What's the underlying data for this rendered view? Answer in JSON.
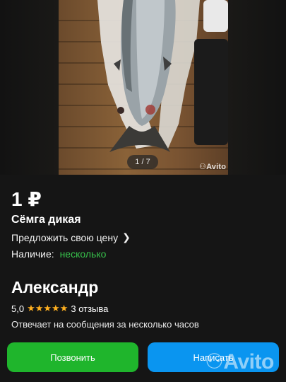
{
  "gallery": {
    "counter": "1 / 7",
    "watermark": "Avito"
  },
  "listing": {
    "price": "1 ₽",
    "title": "Сёмга дикая",
    "offer_link": "Предложить свою цену",
    "availability_label": "Наличие:",
    "availability_value": "несколько"
  },
  "seller": {
    "name": "Александр",
    "rating": "5,0",
    "stars": "★★★★★",
    "reviews": "3 отзыва",
    "response": "Отвечает на сообщения за несколько часов"
  },
  "actions": {
    "call_label": "Позвонить",
    "write_label": "Написать"
  },
  "colors": {
    "accent_green": "#1fb52c",
    "accent_blue": "#0a95f0",
    "availability": "#37c14b",
    "stars": "#ffb020"
  },
  "footer_watermark": "Avito"
}
